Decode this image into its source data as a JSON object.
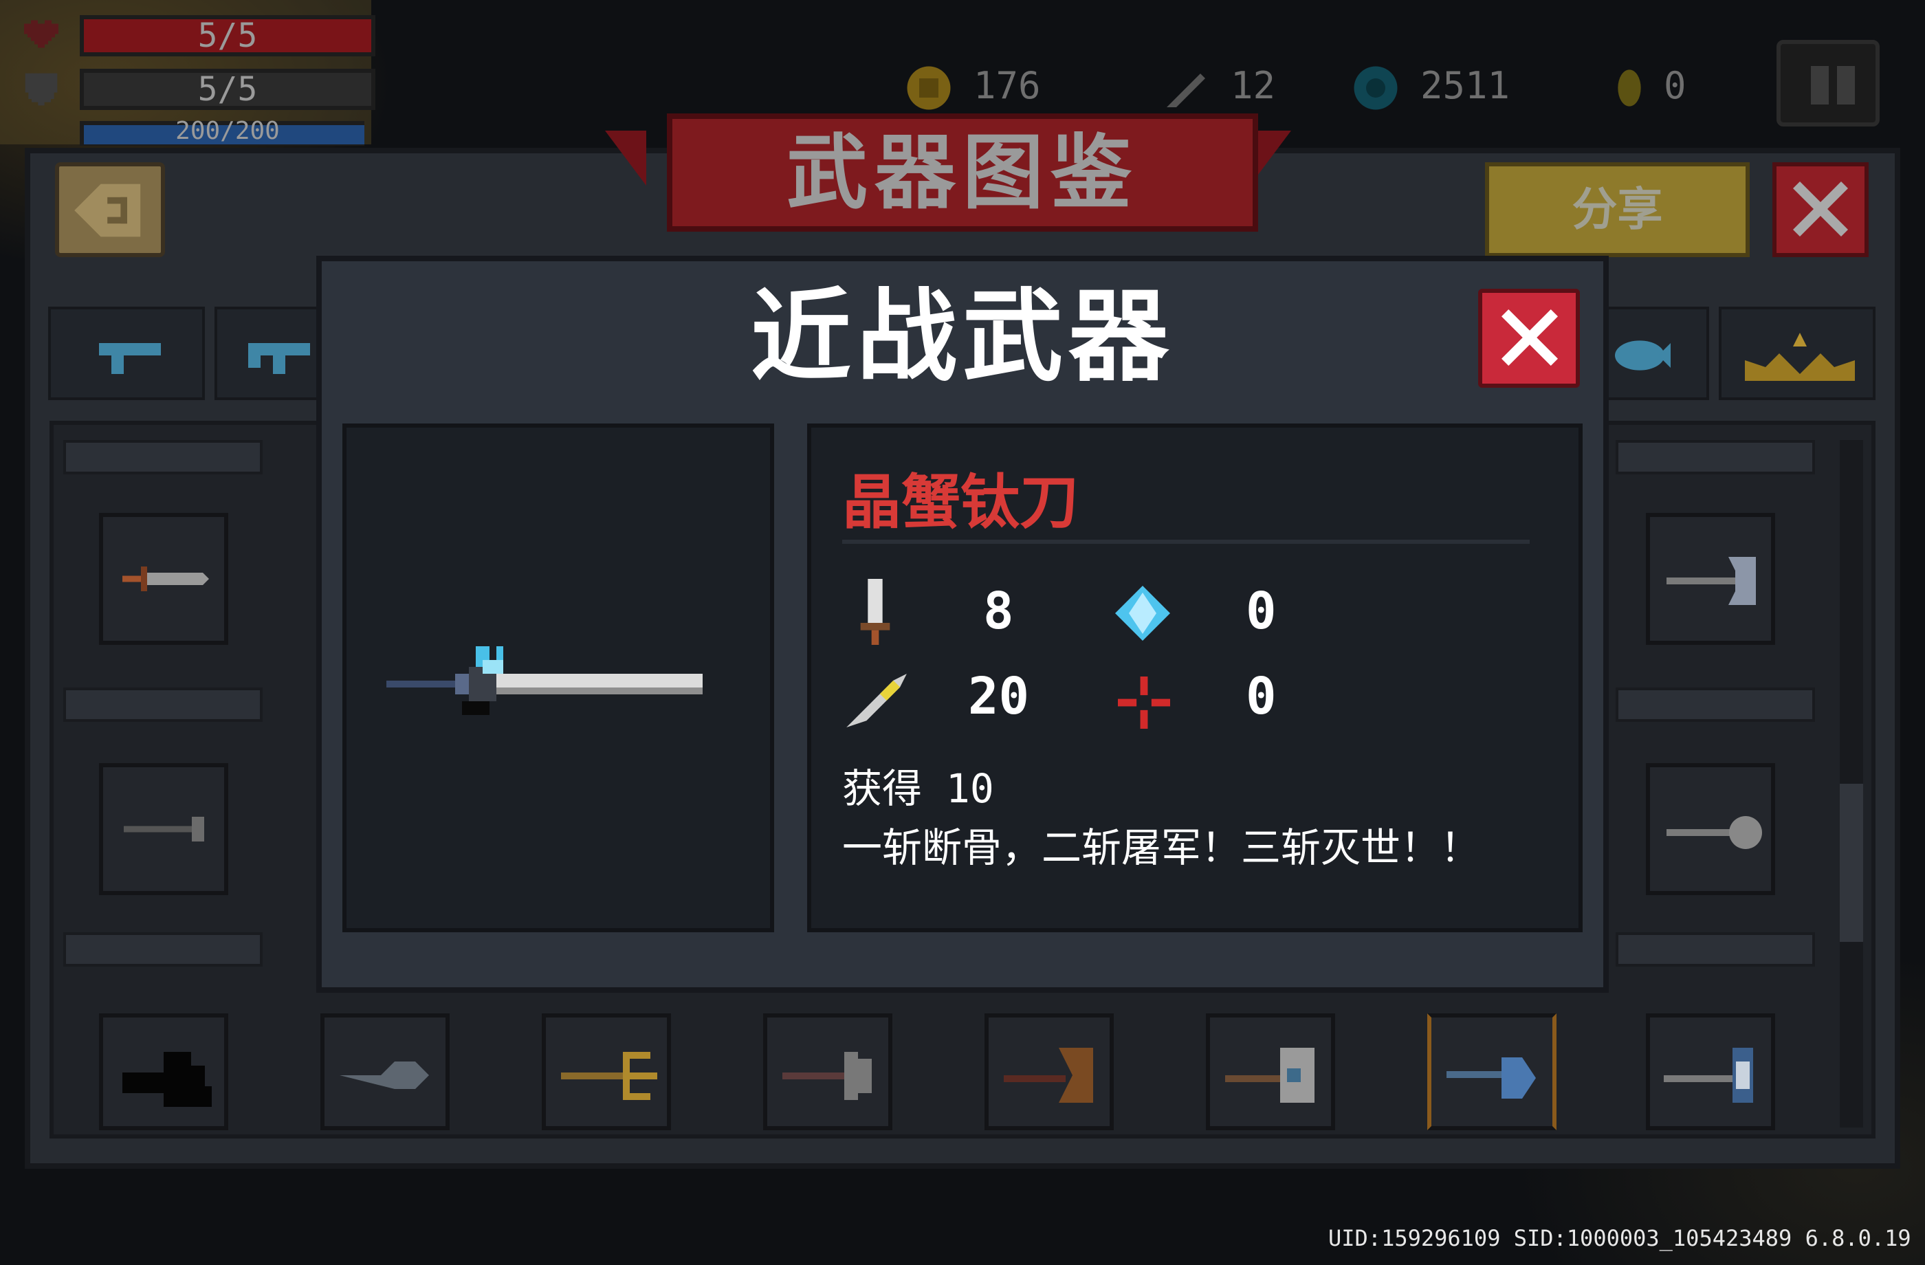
{
  "hud": {
    "hp": "5/5",
    "armor": "5/5",
    "energy": "200/200",
    "colors": {
      "hp": "#7a1418",
      "armor": "#2a2a2a",
      "energy": "#20487e"
    }
  },
  "resources": [
    {
      "icon": "gold-coin-icon",
      "value": "176"
    },
    {
      "icon": "feather-icon",
      "value": "12"
    },
    {
      "icon": "gem-icon",
      "value": "2511"
    },
    {
      "icon": "seed-icon",
      "value": "0"
    }
  ],
  "page": {
    "title": "武器图鉴",
    "share_label": "分享"
  },
  "modal": {
    "title": "近战武器",
    "weapon_name": "晶蟹钛刀",
    "stats": {
      "damage": "8",
      "energy_cost": "0",
      "critical": "20",
      "spread": "0"
    },
    "acquired": "获得 10",
    "description": "一斩断骨，二斩屠军！三斩灭世！！",
    "colors": {
      "name": "#d83a37",
      "close": "#c9293a"
    }
  },
  "footer": {
    "uid": "UID:159296109 SID:1000003_105423489 6.8.0.19"
  }
}
